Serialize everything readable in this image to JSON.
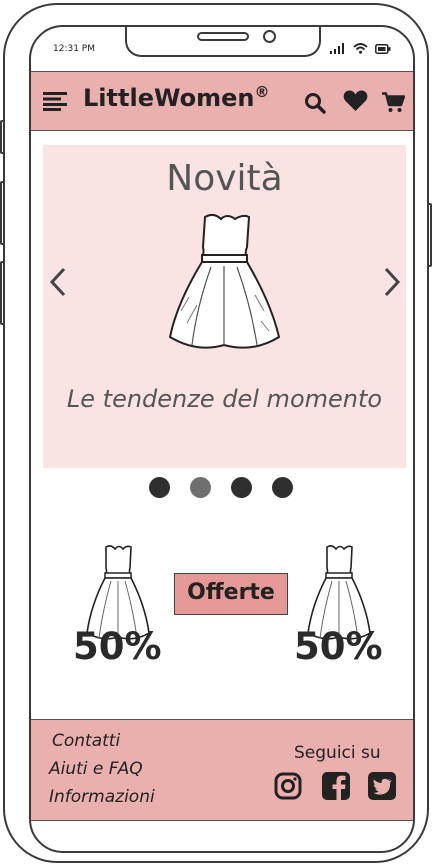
{
  "status": {
    "time": "12:31 PM"
  },
  "header": {
    "brand": "LittleWomen",
    "brand_mark": "®"
  },
  "carousel": {
    "title": "Novità",
    "subtitle": "Le tendenze del momento",
    "slide_count": 4,
    "active_index": 1
  },
  "offers": {
    "button_label": "Offerte",
    "left_discount": "50%",
    "right_discount": "50%"
  },
  "footer": {
    "links": [
      "Contatti",
      "Aiuti e FAQ",
      "Informazioni"
    ],
    "follow_label": "Seguici su",
    "social": [
      "instagram-icon",
      "facebook-icon",
      "twitter-icon"
    ]
  },
  "colors": {
    "header_bg": "#eab0ae",
    "carousel_bg": "#f9e3e3",
    "offer_button_bg": "#e59997",
    "dot": "#2f2f2f",
    "dot_active": "#6f6f6f"
  }
}
